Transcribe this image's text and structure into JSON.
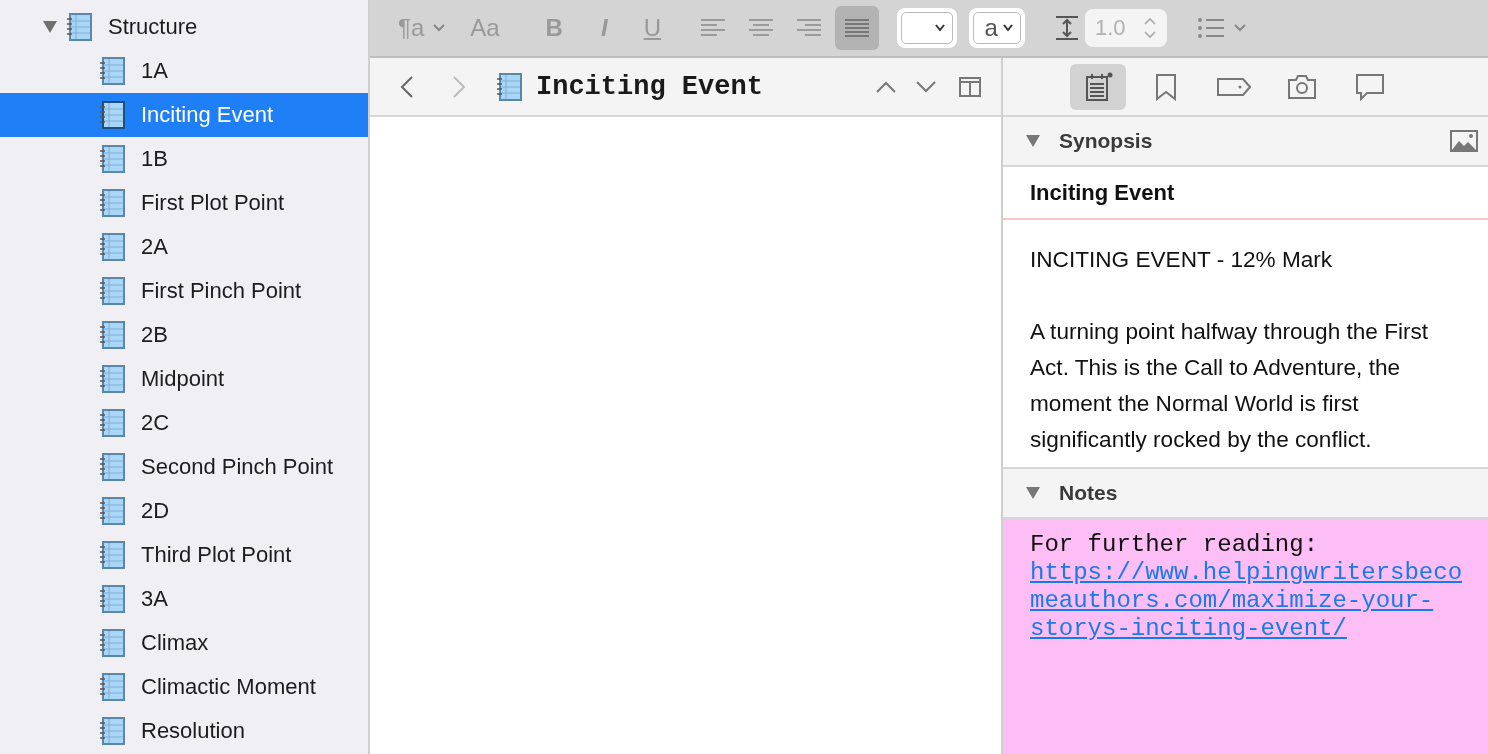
{
  "binder": {
    "items": [
      {
        "label": "Structure",
        "expanded": true,
        "selected": false,
        "children": [
          {
            "label": "1A",
            "selected": false
          },
          {
            "label": "Inciting Event",
            "selected": true
          },
          {
            "label": "1B",
            "selected": false
          },
          {
            "label": "First Plot Point",
            "selected": false
          },
          {
            "label": "2A",
            "selected": false
          },
          {
            "label": "First Pinch Point",
            "selected": false
          },
          {
            "label": "2B",
            "selected": false
          },
          {
            "label": "Midpoint",
            "selected": false
          },
          {
            "label": "2C",
            "selected": false
          },
          {
            "label": "Second Pinch Point",
            "selected": false
          },
          {
            "label": "2D",
            "selected": false
          },
          {
            "label": "Third Plot Point",
            "selected": false
          },
          {
            "label": "3A",
            "selected": false
          },
          {
            "label": "Climax",
            "selected": false
          },
          {
            "label": "Climactic Moment",
            "selected": false
          },
          {
            "label": "Resolution",
            "selected": false
          }
        ]
      }
    ]
  },
  "toolbar": {
    "style_button": "¶a",
    "font_button": "Aa",
    "bold": "B",
    "italic": "I",
    "underline": "U",
    "alignments": [
      {
        "kind": "left",
        "selected": false
      },
      {
        "kind": "center",
        "selected": false
      },
      {
        "kind": "right",
        "selected": false
      },
      {
        "kind": "justify",
        "selected": true
      }
    ],
    "highlight_dropdown": "a",
    "line_spacing": "1.0"
  },
  "editor": {
    "back_disabled": false,
    "forward_disabled": true,
    "title": "Inciting Event"
  },
  "inspector": {
    "tabs": [
      {
        "kind": "notes",
        "selected": true
      },
      {
        "kind": "bookmarks",
        "selected": false
      },
      {
        "kind": "metadata",
        "selected": false
      },
      {
        "kind": "snapshots",
        "selected": false
      },
      {
        "kind": "comments",
        "selected": false
      }
    ],
    "synopsis": {
      "heading": "Synopsis",
      "expanded": true,
      "title": "Inciting Event",
      "paragraphs": [
        "INCITING EVENT - 12% Mark",
        "A turning point halfway through the First Act. This is the Call to Adventure, the moment the Normal World is first significantly rocked by the conflict."
      ]
    },
    "notes": {
      "heading": "Notes",
      "expanded": true,
      "text": "For further reading: ",
      "link": "https://www.helpingwritersbecomeauthors.com/maximize-your-storys-inciting-event/"
    }
  }
}
